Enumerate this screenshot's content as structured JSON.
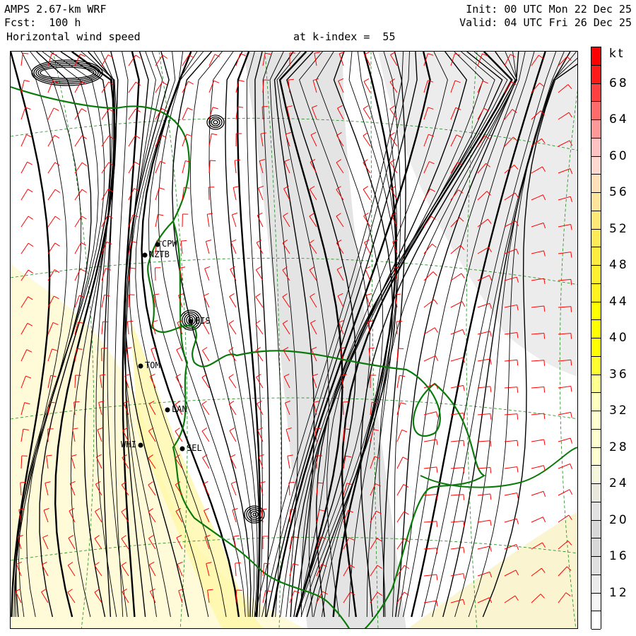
{
  "header": {
    "model": "AMPS 2.67-km WRF",
    "forecast": "Fcst:  100 h",
    "field": "Horizontal wind speed",
    "level": "at k-index =  55",
    "init": "Init: 00 UTC Mon 22 Dec 25",
    "valid": "Valid: 04 UTC Fri 26 Dec 25"
  },
  "colorbar": {
    "unit": "kt",
    "labels": [
      "68",
      "64",
      "60",
      "56",
      "52",
      "48",
      "44",
      "40",
      "36",
      "32",
      "28",
      "24",
      "20",
      "16",
      "12"
    ],
    "colors": [
      "#ff0000",
      "#ff1a1a",
      "#ff4040",
      "#ff6a6a",
      "#ff9898",
      "#ffc2c2",
      "#ffd8d0",
      "#ffe0b8",
      "#ffe49c",
      "#ffe878",
      "#ffea5a",
      "#ffec40",
      "#fff030",
      "#fff420",
      "#ffff00",
      "#ffff00",
      "#ffff00",
      "#ffff30",
      "#ffff90",
      "#ffffc0",
      "#ffffd0",
      "#ffffd0",
      "#ffffd0",
      "#f6f6dc",
      "#e8e8dc",
      "#e2e2e2",
      "#d8d8d8",
      "#d8d8d8",
      "#e0e0e0",
      "#ebebeb",
      "#f6f6f6",
      "#ffffff"
    ]
  },
  "stations": [
    {
      "name": "CPW"
    },
    {
      "name": "NZTB"
    },
    {
      "name": "BIS"
    },
    {
      "name": "TOM"
    },
    {
      "name": "LAN"
    },
    {
      "name": "WHI"
    },
    {
      "name": "SEL"
    }
  ],
  "colors": {
    "coast": "#0a7a0a",
    "barb": "#ff0000",
    "grid": "#1a8a1a"
  }
}
